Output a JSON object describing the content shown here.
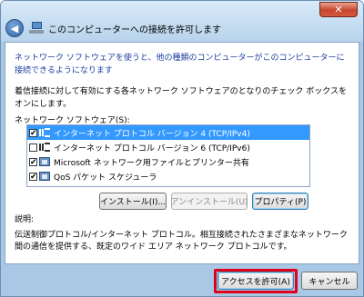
{
  "window": {
    "title": "このコンピューターへの接続を許可します",
    "close_label": "✕",
    "back_label": "◀"
  },
  "intro_text": "ネットワーク ソフトウェアを使うと、他の種類のコンピューターがこのコンピューターに接続できるようになります",
  "instruction_text": "着信接続に対して有効にする各ネットワーク ソフトウェアのとなりのチェック ボックスをオンにします。",
  "list_label": "ネットワーク ソフトウェア(S):",
  "software_list": [
    {
      "label": "インターネット プロトコル バージョン 4 (TCP/IPv4)",
      "checked": true,
      "selected": true,
      "icon": "network-protocol-icon"
    },
    {
      "label": "インターネット プロトコル バージョン 6 (TCP/IPv6)",
      "checked": false,
      "selected": false,
      "icon": "network-protocol-icon"
    },
    {
      "label": "Microsoft ネットワーク用ファイルとプリンター共有",
      "checked": true,
      "selected": false,
      "icon": "network-service-icon"
    },
    {
      "label": "QoS パケット スケジューラ",
      "checked": true,
      "selected": false,
      "icon": "network-service-icon"
    }
  ],
  "buttons": {
    "install": "インストール(I)...",
    "uninstall": "アンインストール(U)",
    "properties": "プロパティ(P)",
    "allow_access": "アクセスを許可(A)",
    "cancel": "キャンセル"
  },
  "description": {
    "title": "説明:",
    "text": "伝送制御プロトコル/インターネット プロトコル。相互接続されたさまざまなネットワーク間の通信を提供する、既定のワイド エリア ネットワーク プロトコルです。"
  }
}
